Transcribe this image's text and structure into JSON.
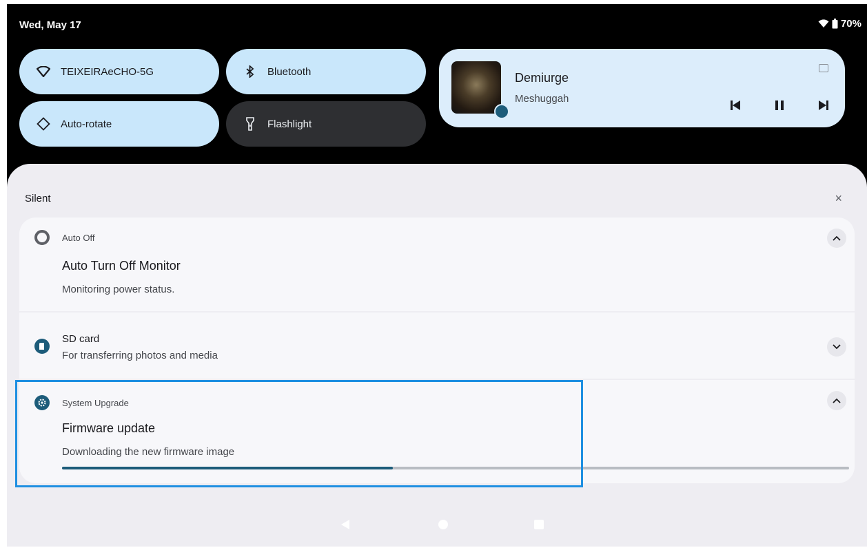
{
  "status": {
    "date": "Wed, May 17",
    "battery": "70%"
  },
  "tiles": {
    "wifi": "TEIXEIRAeCHO-5G",
    "bluetooth": "Bluetooth",
    "rotate": "Auto-rotate",
    "flashlight": "Flashlight"
  },
  "media": {
    "title": "Demiurge",
    "artist": "Meshuggah"
  },
  "shade": {
    "section": "Silent",
    "clear": "×"
  },
  "notifications": [
    {
      "app": "Auto Off",
      "title": "Auto Turn Off Monitor",
      "body": "Monitoring power status."
    },
    {
      "app": "SD card",
      "body": "For transferring photos and media"
    },
    {
      "app": "System Upgrade",
      "title": "Firmware update",
      "body": "Downloading the new firmware image",
      "progress": 0.42
    }
  ],
  "colors": {
    "tile_on": "#c9e7fb",
    "tile_off": "#2e2f32",
    "accent": "#1d5c7a",
    "highlight": "#1e8fe1"
  },
  "icons": {
    "wifi": "wifi-icon",
    "bluetooth": "bluetooth-icon",
    "rotate": "auto-rotate-icon",
    "flashlight": "flashlight-icon",
    "auto_off": "ring-icon",
    "sd": "sd-card-icon",
    "upgrade": "gear-icon"
  }
}
